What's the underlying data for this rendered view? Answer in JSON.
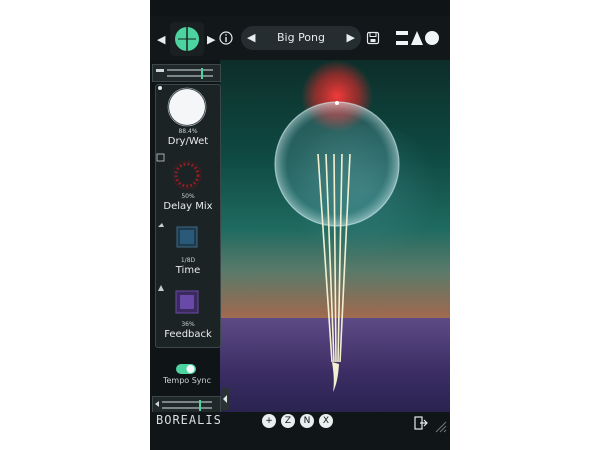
{
  "header": {
    "preset_name": "Big Pong",
    "prev_label": "◀",
    "next_label": "▶",
    "info_label": "i",
    "plugin_logo_icon": "logo-icon",
    "save_icon": "save-icon",
    "brand_mark_icon": "brand-mark-icon"
  },
  "controls": [
    {
      "id": "dry-wet",
      "label": "Dry/Wet",
      "value": "88.4%"
    },
    {
      "id": "delay-mix",
      "label": "Delay Mix",
      "value": "50%"
    },
    {
      "id": "time",
      "label": "Time",
      "value": "1/8D"
    },
    {
      "id": "feedback",
      "label": "Feedback",
      "value": "36%"
    }
  ],
  "tempo_sync": {
    "label": "Tempo Sync",
    "enabled": true
  },
  "footer": {
    "brand": "BOREALIS",
    "modes": [
      "+",
      "Z",
      "N",
      "X"
    ],
    "exit_icon": "exit-icon"
  },
  "colors": {
    "accent_green": "#4cd3a0",
    "accent_red": "#e23a3a",
    "accent_purple": "#6a4aa8",
    "accent_blue": "#2a5a7a"
  }
}
